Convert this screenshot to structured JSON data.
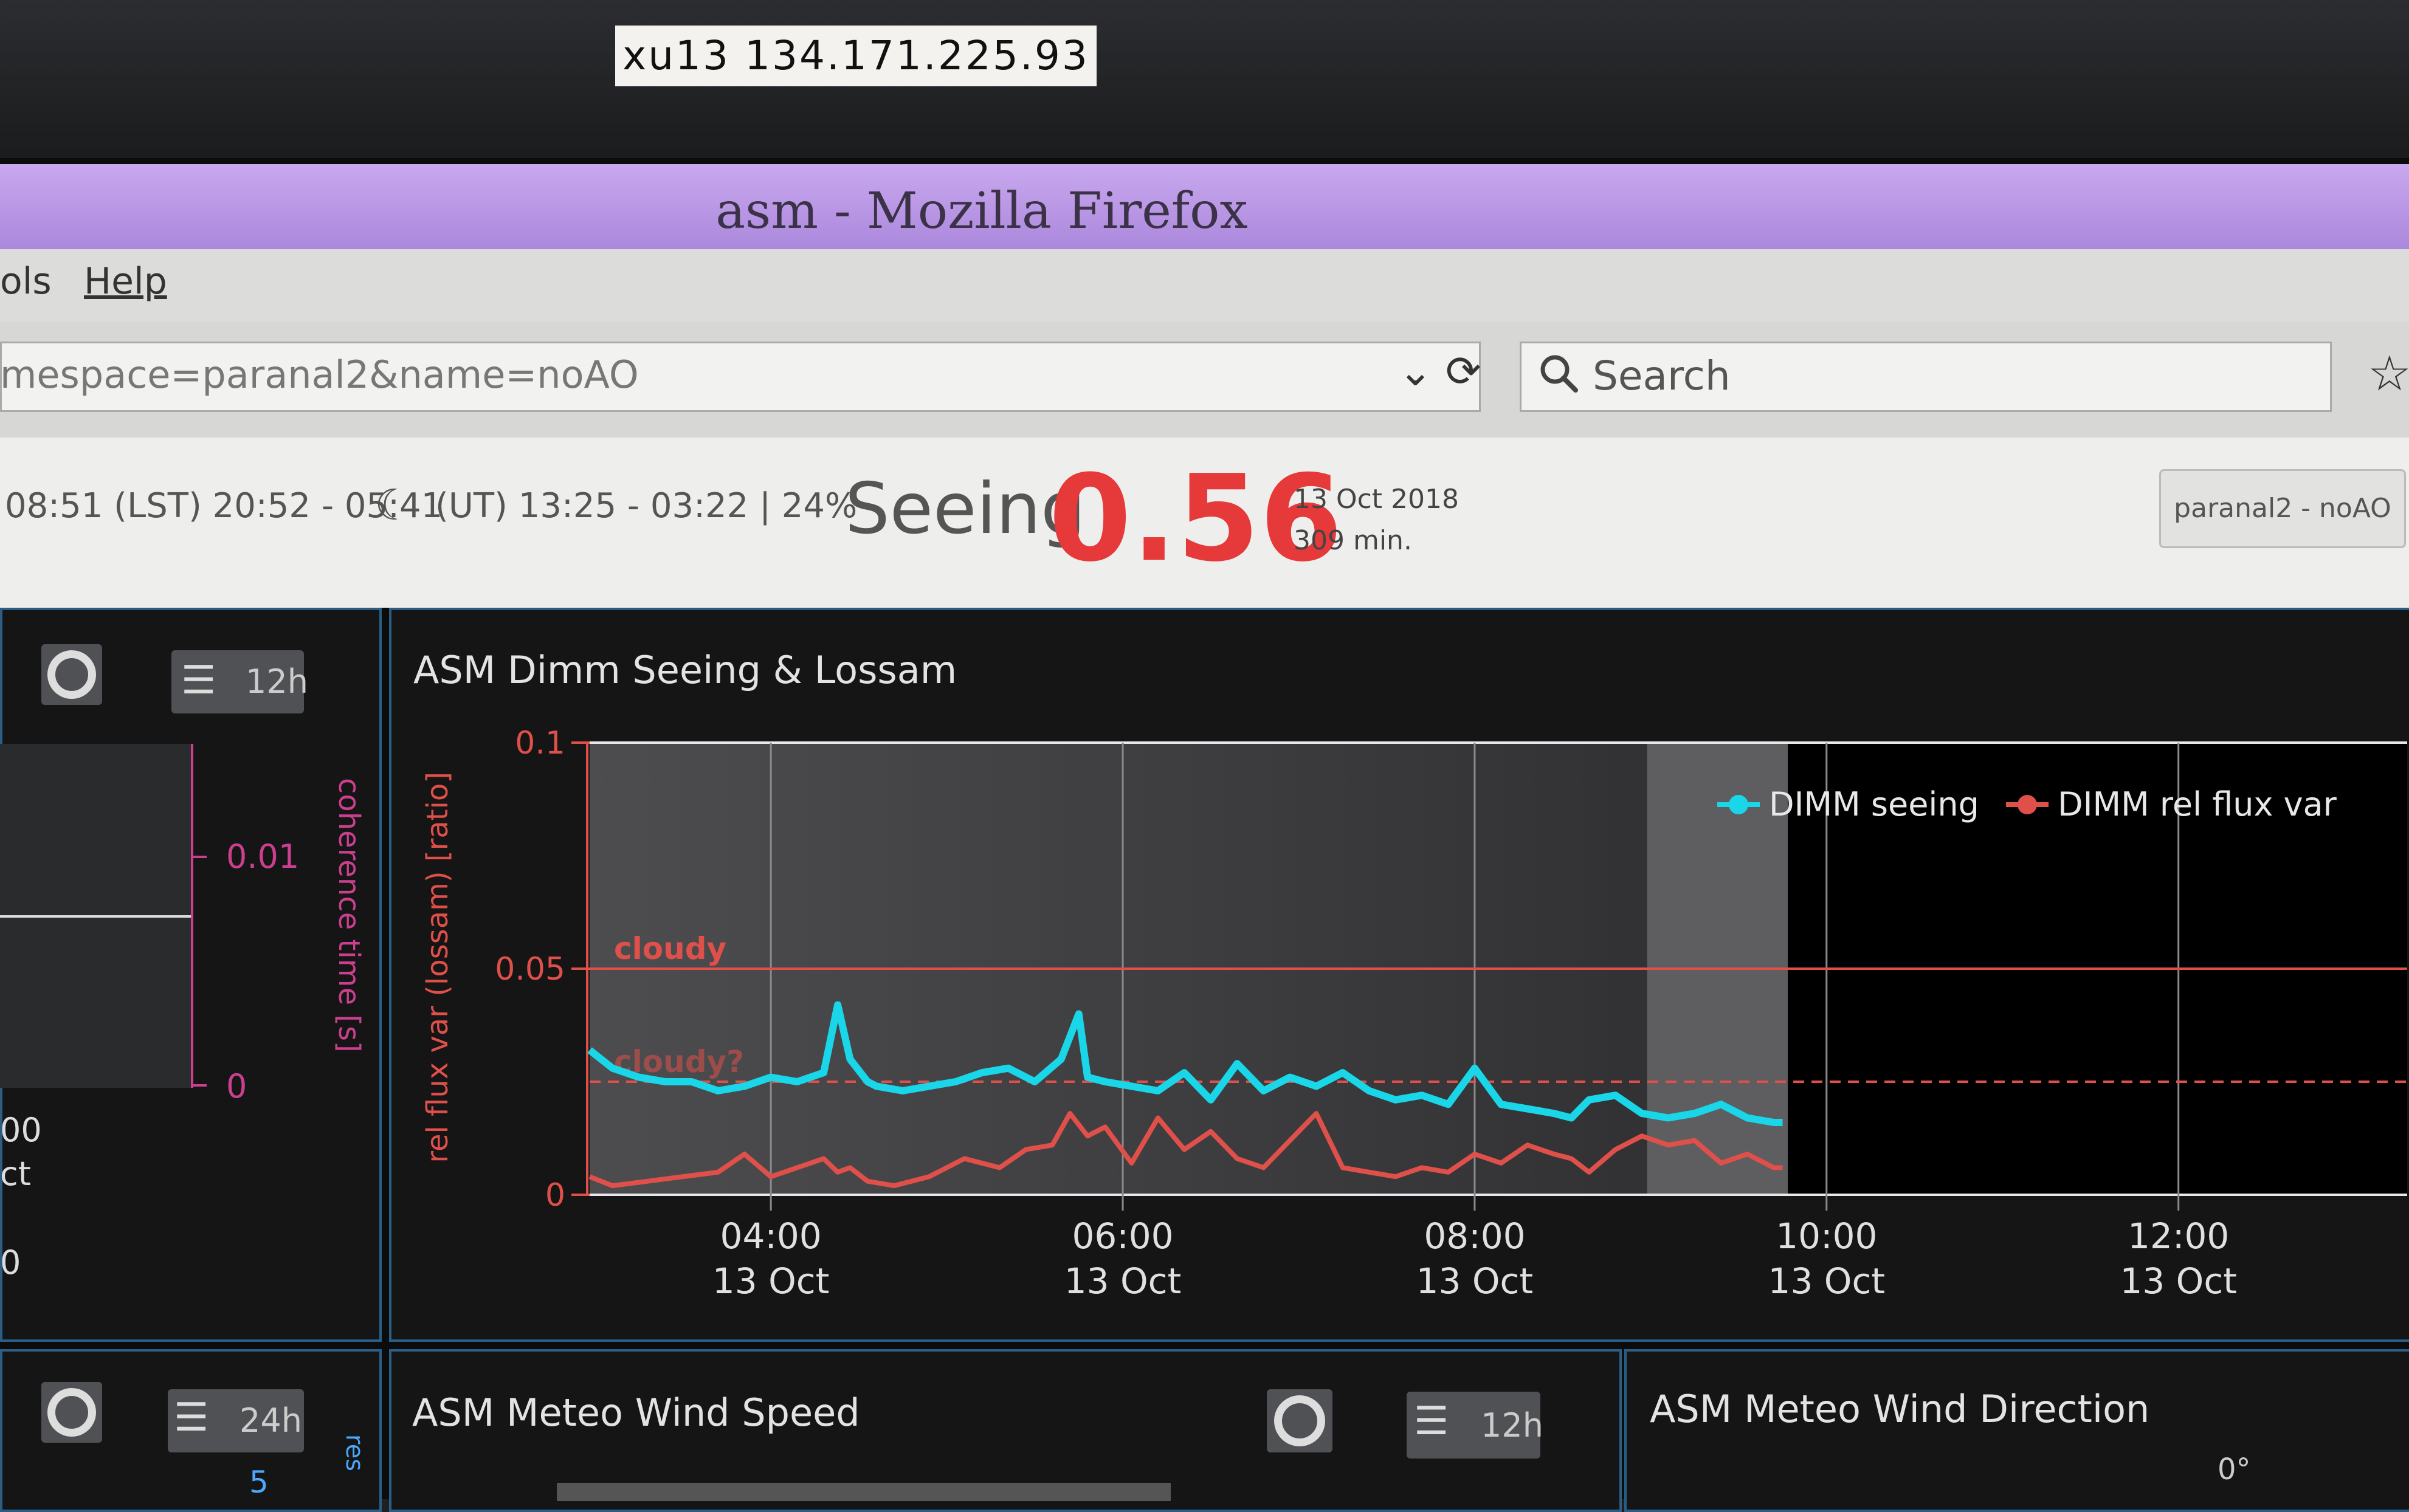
{
  "monitor_label": "xu13 134.171.225.93",
  "window": {
    "title": "asm - Mozilla Firefox"
  },
  "menu": {
    "tools": "ols",
    "help": "Help"
  },
  "address": {
    "url": "mespace=paranal2&name=noAO",
    "search_placeholder": "Search"
  },
  "header": {
    "lst": "08:51 (LST) 20:52 - 05:41",
    "ut": "(UT) 13:25 - 03:22 | 24%",
    "seeing_label": "Seeing",
    "seeing_value": "0.56",
    "date": "13 Oct 2018",
    "duration": "309 min.",
    "context_button": "paranal2 - noAO"
  },
  "colors": {
    "seeing": "#19d6e8",
    "flux": "#e0504a",
    "seeing_big": "#e5393a",
    "coherence": "#cc3f8f"
  },
  "left_panel": {
    "range_label": "12h",
    "axis_ticks": [
      "0.01",
      "0"
    ],
    "axis_label": "coherence time [s]",
    "partial_labels": [
      "00",
      "ct",
      "0"
    ]
  },
  "dimm_panel": {
    "title": "ASM Dimm Seeing & Lossam"
  },
  "bottom_left": {
    "range_label": "24h",
    "partial": [
      "5",
      "res"
    ]
  },
  "wind_speed": {
    "title": "ASM Meteo Wind Speed",
    "range_label": "12h"
  },
  "wind_direction": {
    "title": "ASM Meteo Wind Direction",
    "tick": "0°"
  },
  "chart_data": {
    "type": "line",
    "title": "ASM Dimm Seeing & Lossam",
    "ylabel": "rel flux var (lossam) [ratio]",
    "ylim": [
      0,
      0.1
    ],
    "yticks": [
      "0.1",
      "0.05",
      "0"
    ],
    "xlabel": "",
    "x_ticks": [
      {
        "time": "04:00",
        "date": "13 Oct"
      },
      {
        "time": "06:00",
        "date": "13 Oct"
      },
      {
        "time": "08:00",
        "date": "13 Oct"
      },
      {
        "time": "10:00",
        "date": "13 Oct"
      },
      {
        "time": "12:00",
        "date": "13 Oct"
      }
    ],
    "x_range_hours": [
      2.97,
      13.3
    ],
    "legend_position": "top-right",
    "thresholds": [
      {
        "name": "cloudy",
        "value": 0.05
      },
      {
        "name": "cloudy?",
        "value": 0.025
      }
    ],
    "series": [
      {
        "name": "DIMM seeing",
        "color": "#19d6e8",
        "x": [
          2.97,
          3.1,
          3.25,
          3.4,
          3.55,
          3.7,
          3.85,
          4.0,
          4.15,
          4.3,
          4.38,
          4.45,
          4.55,
          4.6,
          4.75,
          4.9,
          5.05,
          5.2,
          5.35,
          5.5,
          5.65,
          5.75,
          5.8,
          5.9,
          6.05,
          6.2,
          6.35,
          6.5,
          6.65,
          6.8,
          6.95,
          7.1,
          7.25,
          7.4,
          7.55,
          7.7,
          7.85,
          8.0,
          8.15,
          8.3,
          8.45,
          8.55,
          8.65,
          8.8,
          8.95,
          9.1,
          9.25,
          9.4,
          9.55,
          9.7,
          9.75
        ],
        "values": [
          0.032,
          0.028,
          0.026,
          0.025,
          0.025,
          0.023,
          0.024,
          0.026,
          0.025,
          0.027,
          0.042,
          0.03,
          0.025,
          0.024,
          0.023,
          0.024,
          0.025,
          0.027,
          0.028,
          0.025,
          0.03,
          0.04,
          0.026,
          0.025,
          0.024,
          0.023,
          0.027,
          0.021,
          0.029,
          0.023,
          0.026,
          0.024,
          0.027,
          0.023,
          0.021,
          0.022,
          0.02,
          0.028,
          0.02,
          0.019,
          0.018,
          0.017,
          0.021,
          0.022,
          0.018,
          0.017,
          0.018,
          0.02,
          0.017,
          0.016,
          0.016
        ]
      },
      {
        "name": "DIMM rel flux var",
        "color": "#e0504a",
        "x": [
          2.97,
          3.1,
          3.3,
          3.5,
          3.7,
          3.85,
          4.0,
          4.15,
          4.3,
          4.38,
          4.45,
          4.55,
          4.7,
          4.9,
          5.1,
          5.3,
          5.45,
          5.6,
          5.7,
          5.8,
          5.9,
          6.05,
          6.2,
          6.35,
          6.5,
          6.65,
          6.8,
          6.95,
          7.1,
          7.25,
          7.4,
          7.55,
          7.7,
          7.85,
          8.0,
          8.15,
          8.3,
          8.45,
          8.55,
          8.65,
          8.8,
          8.95,
          9.1,
          9.25,
          9.4,
          9.55,
          9.7,
          9.75
        ],
        "values": [
          0.004,
          0.002,
          0.003,
          0.004,
          0.005,
          0.009,
          0.004,
          0.006,
          0.008,
          0.005,
          0.006,
          0.003,
          0.002,
          0.004,
          0.008,
          0.006,
          0.01,
          0.011,
          0.018,
          0.013,
          0.015,
          0.007,
          0.017,
          0.01,
          0.014,
          0.008,
          0.006,
          0.012,
          0.018,
          0.006,
          0.005,
          0.004,
          0.006,
          0.005,
          0.009,
          0.007,
          0.011,
          0.009,
          0.008,
          0.005,
          0.01,
          0.013,
          0.011,
          0.012,
          0.007,
          0.009,
          0.006,
          0.006
        ]
      }
    ]
  }
}
